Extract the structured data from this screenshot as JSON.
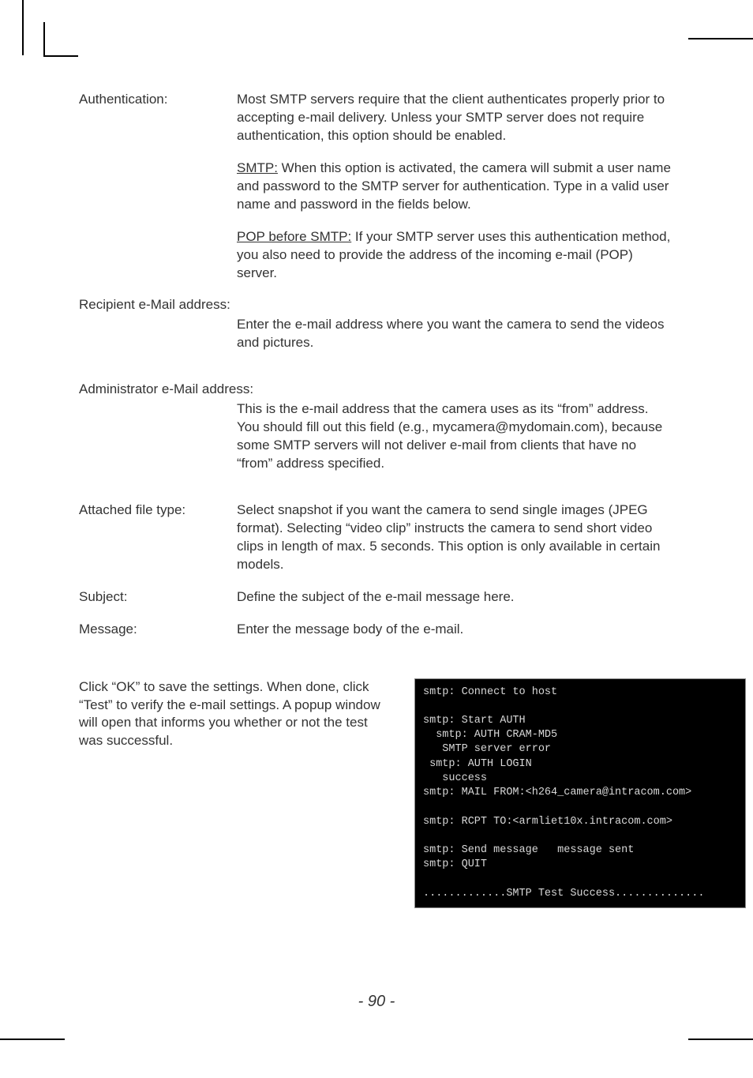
{
  "defs": [
    {
      "label": "Authentication:",
      "paras": [
        {
          "lead": "",
          "text": "Most SMTP servers require that the client authenticates properly prior to accepting e-mail delivery. Unless your SMTP server does not require authentication, this option should be enabled."
        },
        {
          "lead": "SMTP:",
          "text": " When this option is activated, the camera will submit a user name and password to the SMTP server for authentication. Type in a valid user name and password in the fields below."
        },
        {
          "lead": "POP before SMTP:",
          "text": " If your SMTP server uses this authentication method, you also need to provide the address of the incoming e-mail (POP) server."
        }
      ]
    },
    {
      "label": "Recipient e-Mail address:",
      "paras": [
        {
          "lead": "",
          "text": "Enter the e-mail address where you want the camera to send the videos and pictures."
        }
      ]
    },
    {
      "label": "Administrator e-Mail address:",
      "paras": [
        {
          "lead": "",
          "text": "This is the e-mail address that the camera uses as its “from” address. You should fill out this field (e.g., mycamera@mydomain.com), because some SMTP servers will not deliver e-mail from clients that have no “from” address specified."
        }
      ]
    },
    {
      "label": "Attached file type:",
      "paras": [
        {
          "lead": "",
          "text": "Select snapshot if you want the camera to send single images (JPEG format). Selecting “video clip” instructs the camera to send short video clips in length of max. 5 seconds. This option is only available in certain models."
        }
      ]
    },
    {
      "label": "Subject:",
      "paras": [
        {
          "lead": "",
          "text": "Define the subject of the e-mail message here."
        }
      ]
    },
    {
      "label": "Message:",
      "paras": [
        {
          "lead": "",
          "text": "Enter the message body of the e-mail."
        }
      ]
    }
  ],
  "testPara": "Click “OK” to save the settings. When done, click “Test” to verify the e-mail settings. A popup window will open that informs you whether or not the test was successful.",
  "terminal": "smtp: Connect to host\n\nsmtp: Start AUTH\n  smtp: AUTH CRAM-MD5\n   SMTP server error\n smtp: AUTH LOGIN\n   success\nsmtp: MAIL FROM:<h264_camera@intracom.com>\n\nsmtp: RCPT TO:<armliet10x.intracom.com>\n\nsmtp: Send message   message sent\nsmtp: QUIT\n\n.............SMTP Test Success..............",
  "pageNumber": "- 90 -"
}
